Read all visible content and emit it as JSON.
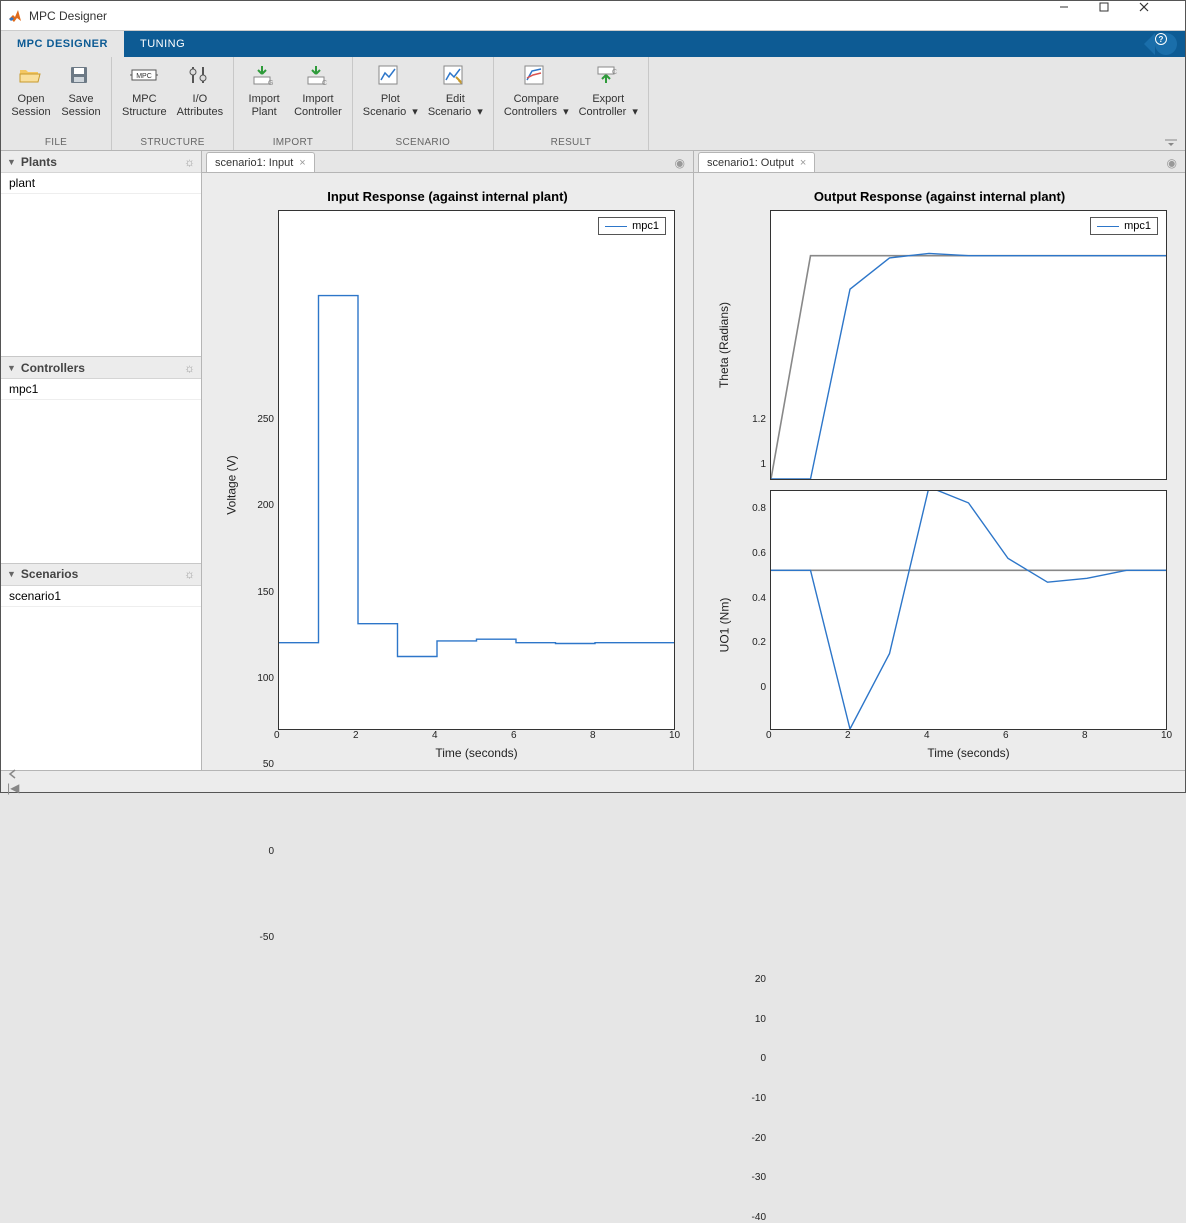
{
  "window": {
    "title": "MPC Designer"
  },
  "tabs": [
    {
      "label": "MPC DESIGNER",
      "active": true
    },
    {
      "label": "TUNING",
      "active": false
    }
  ],
  "toolstrip": {
    "groups": [
      {
        "label": "FILE",
        "buttons": [
          {
            "label": "Open\nSession",
            "icon": "folder-open"
          },
          {
            "label": "Save\nSession",
            "icon": "save"
          }
        ]
      },
      {
        "label": "STRUCTURE",
        "buttons": [
          {
            "label": "MPC\nStructure",
            "icon": "mpc-structure"
          },
          {
            "label": "I/O\nAttributes",
            "icon": "io-attributes"
          }
        ]
      },
      {
        "label": "IMPORT",
        "buttons": [
          {
            "label": "Import\nPlant",
            "icon": "import-plant"
          },
          {
            "label": "Import\nController",
            "icon": "import-controller"
          }
        ]
      },
      {
        "label": "SCENARIO",
        "buttons": [
          {
            "label": "Plot\nScenario",
            "icon": "plot-scenario",
            "dropdown": true
          },
          {
            "label": "Edit\nScenario",
            "icon": "edit-scenario",
            "dropdown": true
          }
        ]
      },
      {
        "label": "RESULT",
        "buttons": [
          {
            "label": "Compare\nControllers",
            "icon": "compare",
            "dropdown": true
          },
          {
            "label": "Export\nController",
            "icon": "export",
            "dropdown": true
          }
        ]
      }
    ]
  },
  "sidebar": {
    "panels": [
      {
        "title": "Plants",
        "items": [
          "plant"
        ]
      },
      {
        "title": "Controllers",
        "items": [
          "mpc1"
        ]
      },
      {
        "title": "Scenarios",
        "items": [
          "scenario1"
        ]
      }
    ]
  },
  "docs": {
    "left": {
      "tab": "scenario1: Input"
    },
    "right": {
      "tab": "scenario1: Output"
    }
  },
  "plots": {
    "input": {
      "title": "Input Response (against internal plant)",
      "legend": "mpc1",
      "xlabel": "Time (seconds)",
      "ylabel": "Voltage (V)"
    },
    "output": {
      "title": "Output Response (against internal plant)",
      "legend": "mpc1",
      "xlabel": "Time (seconds)",
      "ylabel_top": "Theta (Radians)",
      "ylabel_bot": "UO1 (Nm)"
    }
  },
  "chart_data": [
    {
      "id": "input_voltage",
      "type": "line",
      "title": "Input Response (against internal plant)",
      "xlabel": "Time (seconds)",
      "ylabel": "Voltage (V)",
      "xlim": [
        0,
        10
      ],
      "ylim": [
        -50,
        250
      ],
      "xticks": [
        0,
        2,
        4,
        6,
        8,
        10
      ],
      "yticks": [
        -50,
        0,
        50,
        100,
        150,
        200,
        250
      ],
      "legend": [
        "mpc1"
      ],
      "series": [
        {
          "name": "mpc1",
          "x": [
            0,
            1,
            1,
            2,
            2,
            3,
            3,
            4,
            4,
            5,
            5,
            6,
            6,
            7,
            7,
            8,
            8,
            9,
            9,
            10
          ],
          "y": [
            0,
            0,
            201,
            201,
            11,
            11,
            -8,
            -8,
            1,
            1,
            2,
            2,
            0,
            0,
            -0.5,
            -0.5,
            0,
            0,
            0,
            0
          ]
        }
      ]
    },
    {
      "id": "output_theta",
      "type": "line",
      "title": "Output Response (against internal plant)",
      "xlabel": "Time (seconds)",
      "ylabel": "Theta (Radians)",
      "xlim": [
        0,
        10
      ],
      "ylim": [
        0,
        1.2
      ],
      "xticks": [
        0,
        2,
        4,
        6,
        8,
        10
      ],
      "yticks": [
        0,
        0.2,
        0.4,
        0.6,
        0.8,
        1,
        1.2
      ],
      "legend": [
        "mpc1"
      ],
      "series": [
        {
          "name": "reference",
          "x": [
            0,
            1,
            10
          ],
          "y": [
            0,
            1,
            1
          ],
          "style": "ref"
        },
        {
          "name": "mpc1",
          "x": [
            0,
            1,
            2,
            3,
            4,
            5,
            6,
            7,
            8,
            9,
            10
          ],
          "y": [
            0,
            0,
            0.85,
            0.99,
            1.01,
            1.0,
            1.0,
            1.0,
            1.0,
            1.0,
            1.0
          ]
        }
      ]
    },
    {
      "id": "output_uo1",
      "type": "line",
      "title": "Output Response (against internal plant)",
      "xlabel": "Time (seconds)",
      "ylabel": "UO1 (Nm)",
      "xlim": [
        0,
        10
      ],
      "ylim": [
        -40,
        20
      ],
      "xticks": [
        0,
        2,
        4,
        6,
        8,
        10
      ],
      "yticks": [
        -40,
        -30,
        -20,
        -10,
        0,
        10,
        20
      ],
      "legend": [
        "mpc1"
      ],
      "series": [
        {
          "name": "reference",
          "x": [
            0,
            10
          ],
          "y": [
            0,
            0
          ],
          "style": "ref"
        },
        {
          "name": "mpc1",
          "x": [
            0,
            1,
            2,
            3,
            4,
            5,
            6,
            7,
            8,
            9,
            10
          ],
          "y": [
            0,
            0,
            -40,
            -21,
            21,
            17,
            3,
            -3,
            -2,
            0,
            0
          ]
        }
      ]
    }
  ]
}
